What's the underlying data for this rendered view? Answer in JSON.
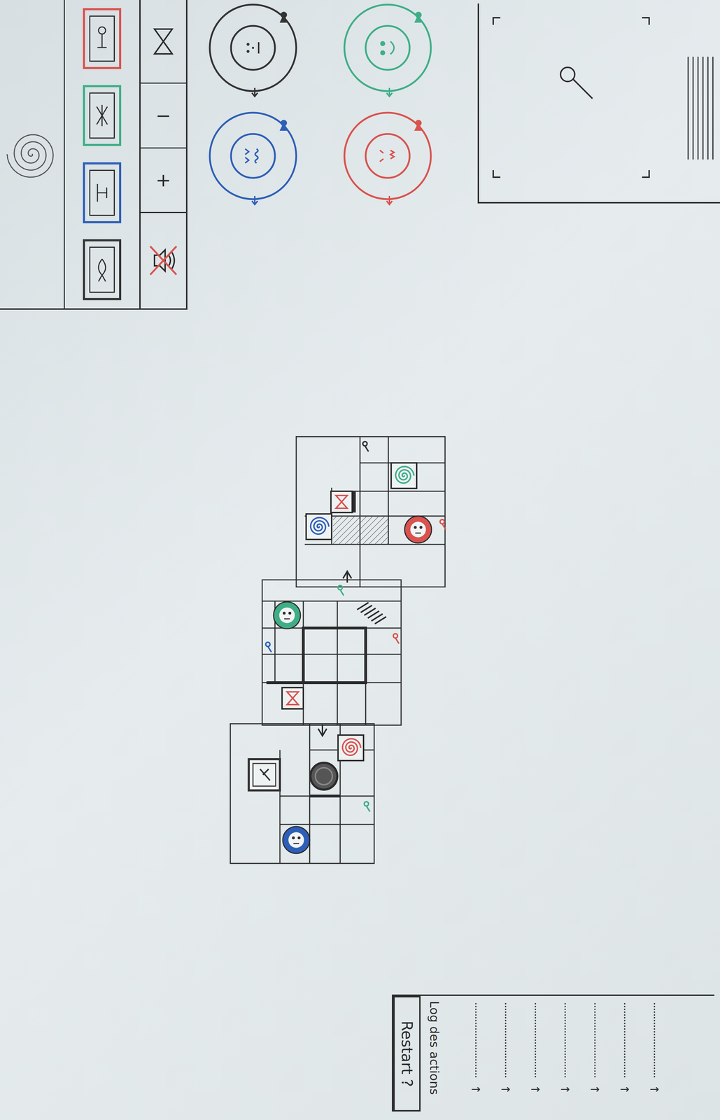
{
  "inventory": {
    "cards": [
      {
        "color": "#d9534f",
        "kind": "figure"
      },
      {
        "color": "#3fae86",
        "kind": "cross"
      },
      {
        "color": "#2e5fb8",
        "kind": "gate"
      },
      {
        "color": "#333333",
        "kind": "fish"
      }
    ]
  },
  "toolbar": [
    {
      "kind": "hourglass",
      "label": ""
    },
    {
      "kind": "text",
      "label": "−"
    },
    {
      "kind": "text",
      "label": "+"
    },
    {
      "kind": "sound",
      "label": "",
      "muted": true
    }
  ],
  "players": [
    {
      "color": "#333333",
      "kind": "neutral"
    },
    {
      "color": "#3fae86",
      "kind": "happy"
    },
    {
      "color": "#2e5fb8",
      "kind": "worried"
    },
    {
      "color": "#d9534f",
      "kind": "angry"
    }
  ],
  "board": {
    "tokens": [
      {
        "kind": "key",
        "color": "#333333"
      },
      {
        "kind": "spiral",
        "color": "#3fae86"
      },
      {
        "kind": "hourglass",
        "color": "#d9534f"
      },
      {
        "kind": "spiral",
        "color": "#2e5fb8"
      },
      {
        "kind": "player",
        "color": "#d9534f"
      },
      {
        "kind": "key",
        "color": "#d9534f"
      },
      {
        "kind": "player",
        "color": "#3fae86"
      },
      {
        "kind": "hourglass",
        "color": "#d9534f"
      },
      {
        "kind": "key",
        "color": "#2e5fb8"
      },
      {
        "kind": "key",
        "color": "#d9534f"
      },
      {
        "kind": "key",
        "color": "#3fae86"
      },
      {
        "kind": "spiral",
        "color": "#d9534f"
      },
      {
        "kind": "rune",
        "color": "#333333"
      },
      {
        "kind": "coin",
        "color": "#555555"
      },
      {
        "kind": "player",
        "color": "#2e5fb8"
      },
      {
        "kind": "key",
        "color": "#3fae86"
      }
    ]
  },
  "log": {
    "restart": "Restart ?",
    "title": "Log des actions",
    "marker": "→",
    "entries": [
      {
        "kind": "placeholder"
      },
      {
        "kind": "placeholder"
      },
      {
        "kind": "placeholder"
      },
      {
        "kind": "placeholder"
      },
      {
        "kind": "placeholder"
      },
      {
        "kind": "placeholder"
      },
      {
        "kind": "placeholder"
      }
    ]
  }
}
